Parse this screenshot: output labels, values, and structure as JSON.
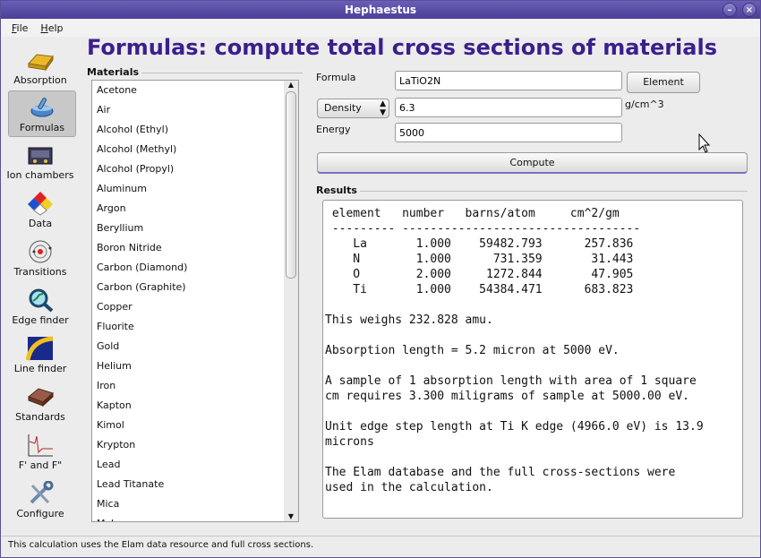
{
  "window": {
    "title": "Hephaestus"
  },
  "menu": [
    {
      "label": "File",
      "underline": "F",
      "rest": "ile"
    },
    {
      "label": "Help",
      "underline": "H",
      "rest": "elp"
    }
  ],
  "sidebar": {
    "items": [
      {
        "label": "Absorption",
        "icon": "gold-bar-icon"
      },
      {
        "label": "Formulas",
        "icon": "mortar-pestle-icon",
        "selected": true
      },
      {
        "label": "Ion chambers",
        "icon": "ion-chamber-icon"
      },
      {
        "label": "Data",
        "icon": "hazard-diamond-icon"
      },
      {
        "label": "Transitions",
        "icon": "atom-icon"
      },
      {
        "label": "Edge finder",
        "icon": "magnifier-icon"
      },
      {
        "label": "Line finder",
        "icon": "spectrum-icon"
      },
      {
        "label": "Standards",
        "icon": "sample-case-icon"
      },
      {
        "label": "F' and F\"",
        "icon": "anomalous-plot-icon"
      },
      {
        "label": "Configure",
        "icon": "tools-icon"
      }
    ]
  },
  "page_title": "Formulas: compute total cross sections of materials",
  "materials": {
    "label": "Materials",
    "items": [
      "Acetone",
      "Air",
      "Alcohol (Ethyl)",
      "Alcohol (Methyl)",
      "Alcohol (Propyl)",
      "Aluminum",
      "Argon",
      "Beryllium",
      "Boron Nitride",
      "Carbon (Diamond)",
      "Carbon (Graphite)",
      "Copper",
      "Fluorite",
      "Gold",
      "Helium",
      "Iron",
      "Kapton",
      "Kimol",
      "Krypton",
      "Lead",
      "Lead Titanate",
      "Mica",
      "Mylar"
    ]
  },
  "form": {
    "formula_label": "Formula",
    "formula_value": "LaTiO2N",
    "element_button": "Element",
    "density_select": "Density",
    "density_value": "6.3",
    "density_unit": "g/cm^3",
    "energy_label": "Energy",
    "energy_value": "5000",
    "compute_button": "Compute"
  },
  "results": {
    "label": "Results",
    "text": " element   number   barns/atom     cm^2/gm\n --------- ----------------------------------\n    La       1.000    59482.793      257.836\n    N        1.000      731.359       31.443\n    O        2.000     1272.844       47.905\n    Ti       1.000    54384.471      683.823\n\nThis weighs 232.828 amu.\n\nAbsorption length = 5.2 micron at 5000 eV.\n\nA sample of 1 absorption length with area of 1 square\ncm requires 3.300 miligrams of sample at 5000.00 eV.\n\nUnit edge step length at Ti K edge (4966.0 eV) is 13.9\nmicrons\n\nThe Elam database and the full cross-sections were\nused in the calculation."
  },
  "status": "This calculation uses the Elam data resource and full cross sections.",
  "colors": {
    "title_purple": "#3b1f8c",
    "titlebar": "#4a3f96",
    "compute_accent": "#7a70c0"
  }
}
